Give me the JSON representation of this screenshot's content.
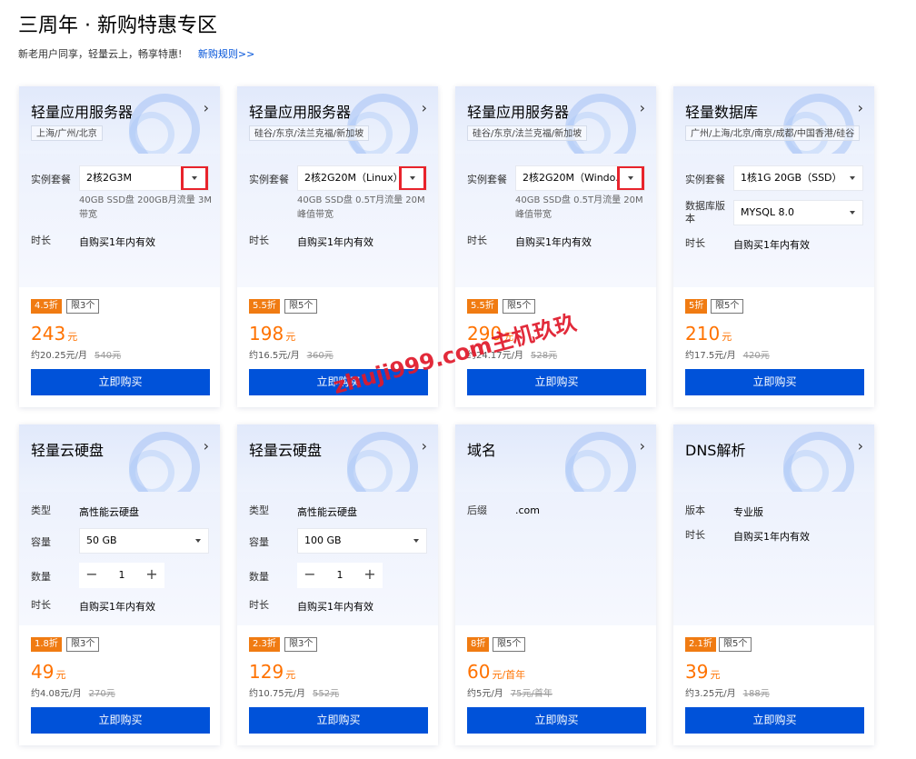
{
  "page": {
    "title": "三周年 · 新购特惠专区",
    "subtitle": "新老用户同享，轻量云上，畅享特惠!",
    "rules_link": "新购规则>>"
  },
  "labels": {
    "spec": "实例套餐",
    "duration": "时长",
    "db_version": "数据库版本",
    "type": "类型",
    "capacity": "容量",
    "quantity": "数量",
    "suffix": "后缀",
    "edition": "版本",
    "buy": "立即购买",
    "chevron": "›"
  },
  "accent": {
    "buy_button": "#0052d9",
    "price": "#ff7200",
    "discount_badge": "#f07b12",
    "highlight_box": "#e8232c"
  },
  "cards": [
    {
      "title": "轻量应用服务器",
      "region": "上海/广州/北京",
      "spec_value": "2核2G3M",
      "spec_note": "40GB SSD盘 200GB月流量 3M带宽",
      "duration_value": "自购买1年内有效",
      "discount": "4.5折",
      "limit": "限3个",
      "price": "243",
      "price_unit": "元",
      "monthly": "约20.25元/月",
      "original": "540元"
    },
    {
      "title": "轻量应用服务器",
      "region": "硅谷/东京/法兰克福/新加坡",
      "spec_value": "2核2G20M（Linux）",
      "spec_note": "40GB SSD盘 0.5T月流量 20M峰值带宽",
      "duration_value": "自购买1年内有效",
      "discount": "5.5折",
      "limit": "限5个",
      "price": "198",
      "price_unit": "元",
      "monthly": "约16.5元/月",
      "original": "360元"
    },
    {
      "title": "轻量应用服务器",
      "region": "硅谷/东京/法兰克福/新加坡",
      "spec_value": "2核2G20M（Windo...",
      "spec_note": "40GB SSD盘 0.5T月流量 20M峰值带宽",
      "duration_value": "自购买1年内有效",
      "discount": "5.5折",
      "limit": "限5个",
      "price": "290",
      "price_unit": "元",
      "monthly": "约24.17元/月",
      "original": "528元"
    },
    {
      "title": "轻量数据库",
      "region": "广州/上海/北京/南京/成都/中国香港/硅谷",
      "spec_value": "1核1G 20GB（SSD）",
      "db_version_value": "MYSQL 8.0",
      "duration_value": "自购买1年内有效",
      "discount": "5折",
      "limit": "限5个",
      "price": "210",
      "price_unit": "元",
      "monthly": "约17.5元/月",
      "original": "420元"
    },
    {
      "title": "轻量云硬盘",
      "type_value": "高性能云硬盘",
      "capacity_value": "50 GB",
      "quantity_value": "1",
      "duration_value": "自购买1年内有效",
      "discount": "1.8折",
      "limit": "限3个",
      "price": "49",
      "price_unit": "元",
      "monthly": "约4.08元/月",
      "original": "270元"
    },
    {
      "title": "轻量云硬盘",
      "type_value": "高性能云硬盘",
      "capacity_value": "100 GB",
      "quantity_value": "1",
      "duration_value": "自购买1年内有效",
      "discount": "2.3折",
      "limit": "限3个",
      "price": "129",
      "price_unit": "元",
      "monthly": "约10.75元/月",
      "original": "552元"
    },
    {
      "title": "域名",
      "suffix_value": ".com",
      "discount": "8折",
      "limit": "限5个",
      "price": "60",
      "price_unit": "元/首年",
      "monthly": "约5元/月",
      "original": "75元/首年"
    },
    {
      "title": "DNS解析",
      "edition_value": "专业版",
      "duration_value": "自购买1年内有效",
      "discount": "2.1折",
      "limit": "限5个",
      "price": "39",
      "price_unit": "元",
      "monthly": "约3.25元/月",
      "original": "188元"
    }
  ],
  "watermark": "zhuji999.com主机玖玖"
}
